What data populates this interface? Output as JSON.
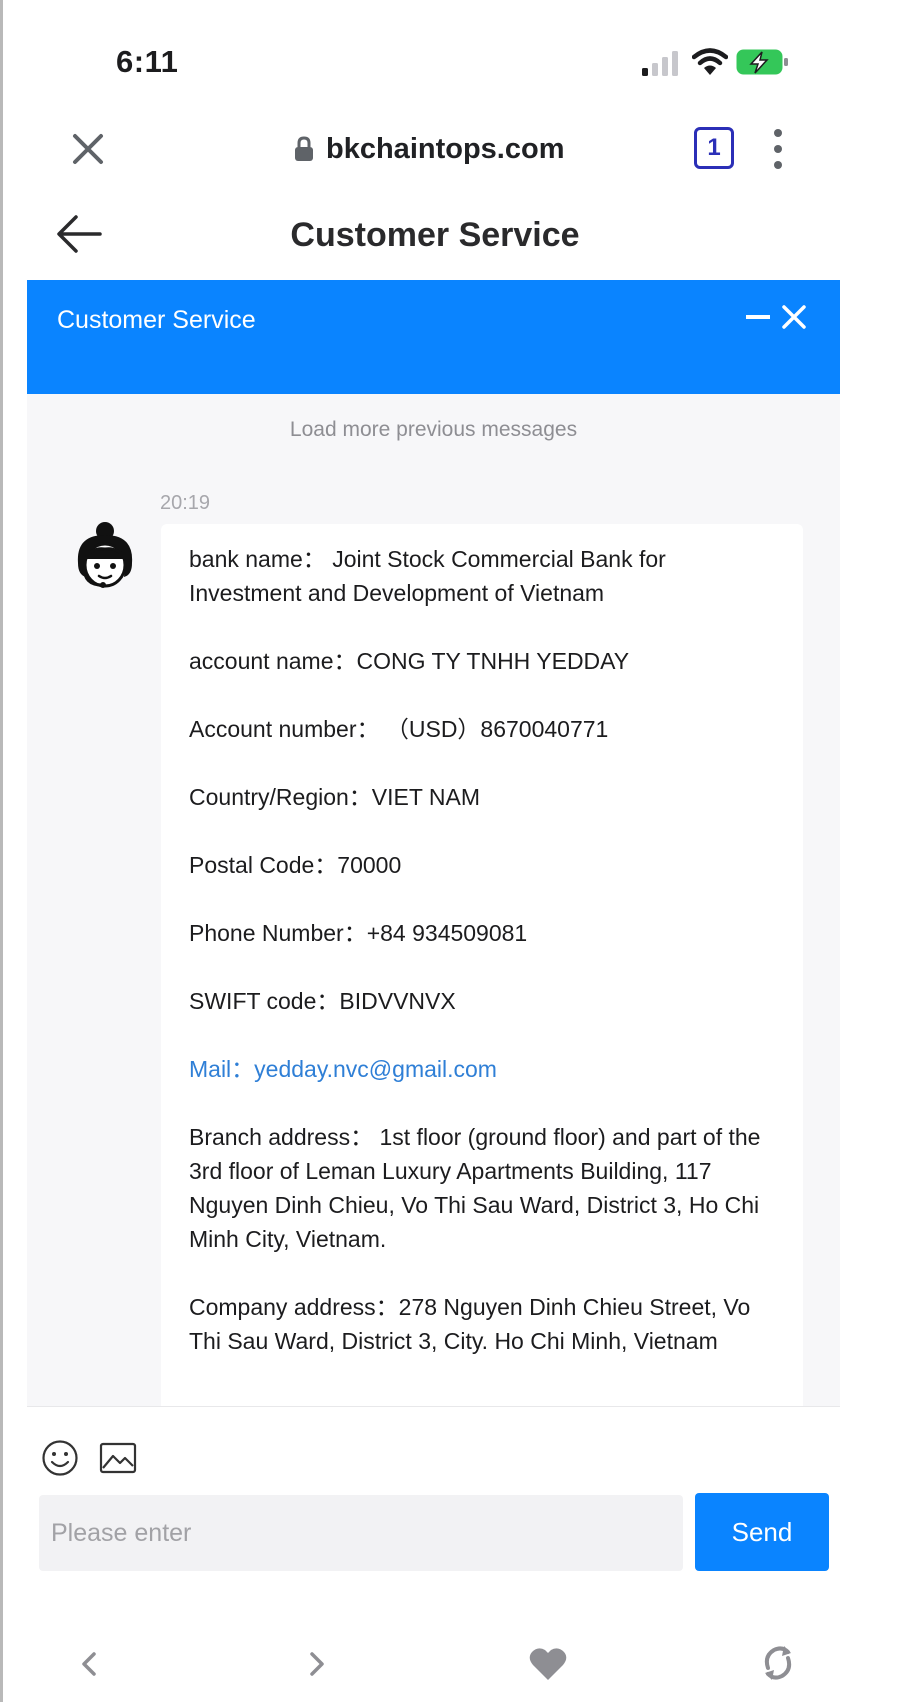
{
  "status_bar": {
    "time": "6:11"
  },
  "browser": {
    "url": "bkchaintops.com",
    "tab_count": "1"
  },
  "page": {
    "title": "Customer Service"
  },
  "chat": {
    "header_title": "Customer Service",
    "load_more": "Load more previous messages",
    "message": {
      "time": "20:19",
      "lines": [
        "bank name：  Joint Stock Commercial Bank for Investment and Development of Vietnam",
        "account name：CONG TY TNHH YEDDAY",
        "Account number：  （USD）8670040771",
        "Country/Region：VIET NAM",
        "Postal Code：70000",
        "Phone Number：+84 934509081",
        "SWIFT code：BIDVVNVX",
        "Mail：yedday.nvc@gmail.com",
        "Branch address：  1st floor (ground floor) and part of the 3rd floor of Leman Luxury Apartments Building, 117 Nguyen Dinh Chieu, Vo Thi Sau Ward, District 3, Ho Chi Minh City, Vietnam.",
        "Company address：278 Nguyen Dinh Chieu Street, Vo Thi Sau Ward, District 3, City. Ho Chi Minh, Vietnam"
      ]
    },
    "input": {
      "placeholder": "Please enter",
      "value": ""
    },
    "send_label": "Send"
  },
  "colors": {
    "accent": "#0a84ff",
    "link": "#2f7fd6",
    "tab_badge": "#2b2fb7",
    "battery_charging": "#34c759"
  },
  "icons": {
    "status": [
      "cellular-signal-icon",
      "wifi-icon",
      "battery-charging-icon"
    ],
    "browser": [
      "close-icon",
      "lock-icon",
      "tabs-icon",
      "more-vertical-icon"
    ],
    "chat": [
      "back-arrow-icon",
      "minimize-icon",
      "close-icon",
      "agent-avatar-icon",
      "emoji-icon",
      "image-icon"
    ],
    "toolbar": [
      "chevron-left-icon",
      "chevron-right-icon",
      "heart-icon",
      "refresh-icon"
    ]
  }
}
